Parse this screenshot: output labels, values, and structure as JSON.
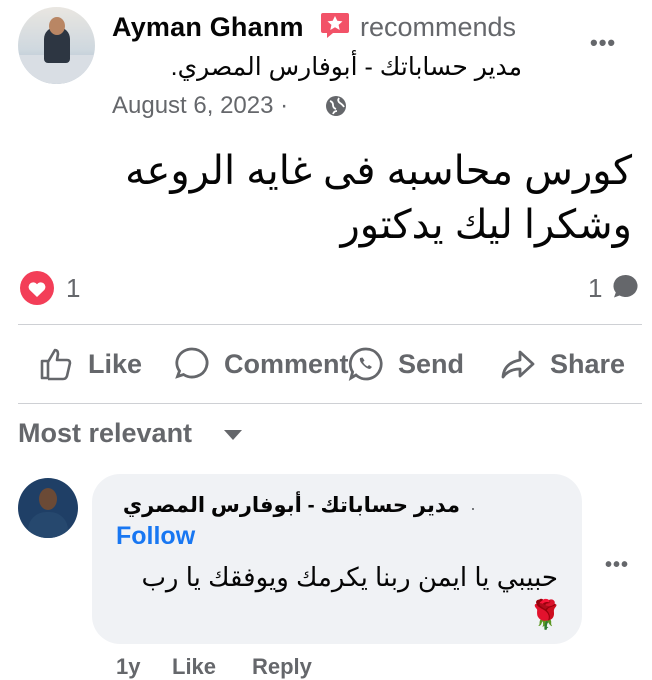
{
  "post": {
    "author": "Ayman Ghanm",
    "action": "recommends",
    "subtitle": "مدير حساباتك - أبوفارس المصري.",
    "date": "August 6, 2023 ·",
    "text_line1": "كورس محاسبه فى غايه الروعه",
    "text_line2": "وشكرا ليك يدكتور",
    "more_label": "•••"
  },
  "stats": {
    "reactions": "1",
    "comments": "1"
  },
  "actions": {
    "like": "Like",
    "comment": "Comment",
    "send": "Send",
    "share": "Share"
  },
  "sort": {
    "label": "Most relevant"
  },
  "comment": {
    "author": "مدير حساباتك - أبوفارس المصري",
    "dot": "·",
    "follow": "Follow",
    "text": "حبيبي يا ايمن ربنا يكرمك ويوفقك يا رب",
    "emoji": "🌹",
    "more_label": "•••",
    "age": "1y",
    "like": "Like",
    "reply": "Reply"
  },
  "colors": {
    "brand_blue": "#1877f2",
    "heart": "#f33e58",
    "badge": "#f25268",
    "muted": "#65676b"
  },
  "icons": [
    "recommend-badge-icon",
    "globe-icon",
    "heart-reaction-icon",
    "comment-bubble-icon",
    "like-icon",
    "comment-icon",
    "send-icon",
    "share-icon",
    "caret-down-icon"
  ]
}
